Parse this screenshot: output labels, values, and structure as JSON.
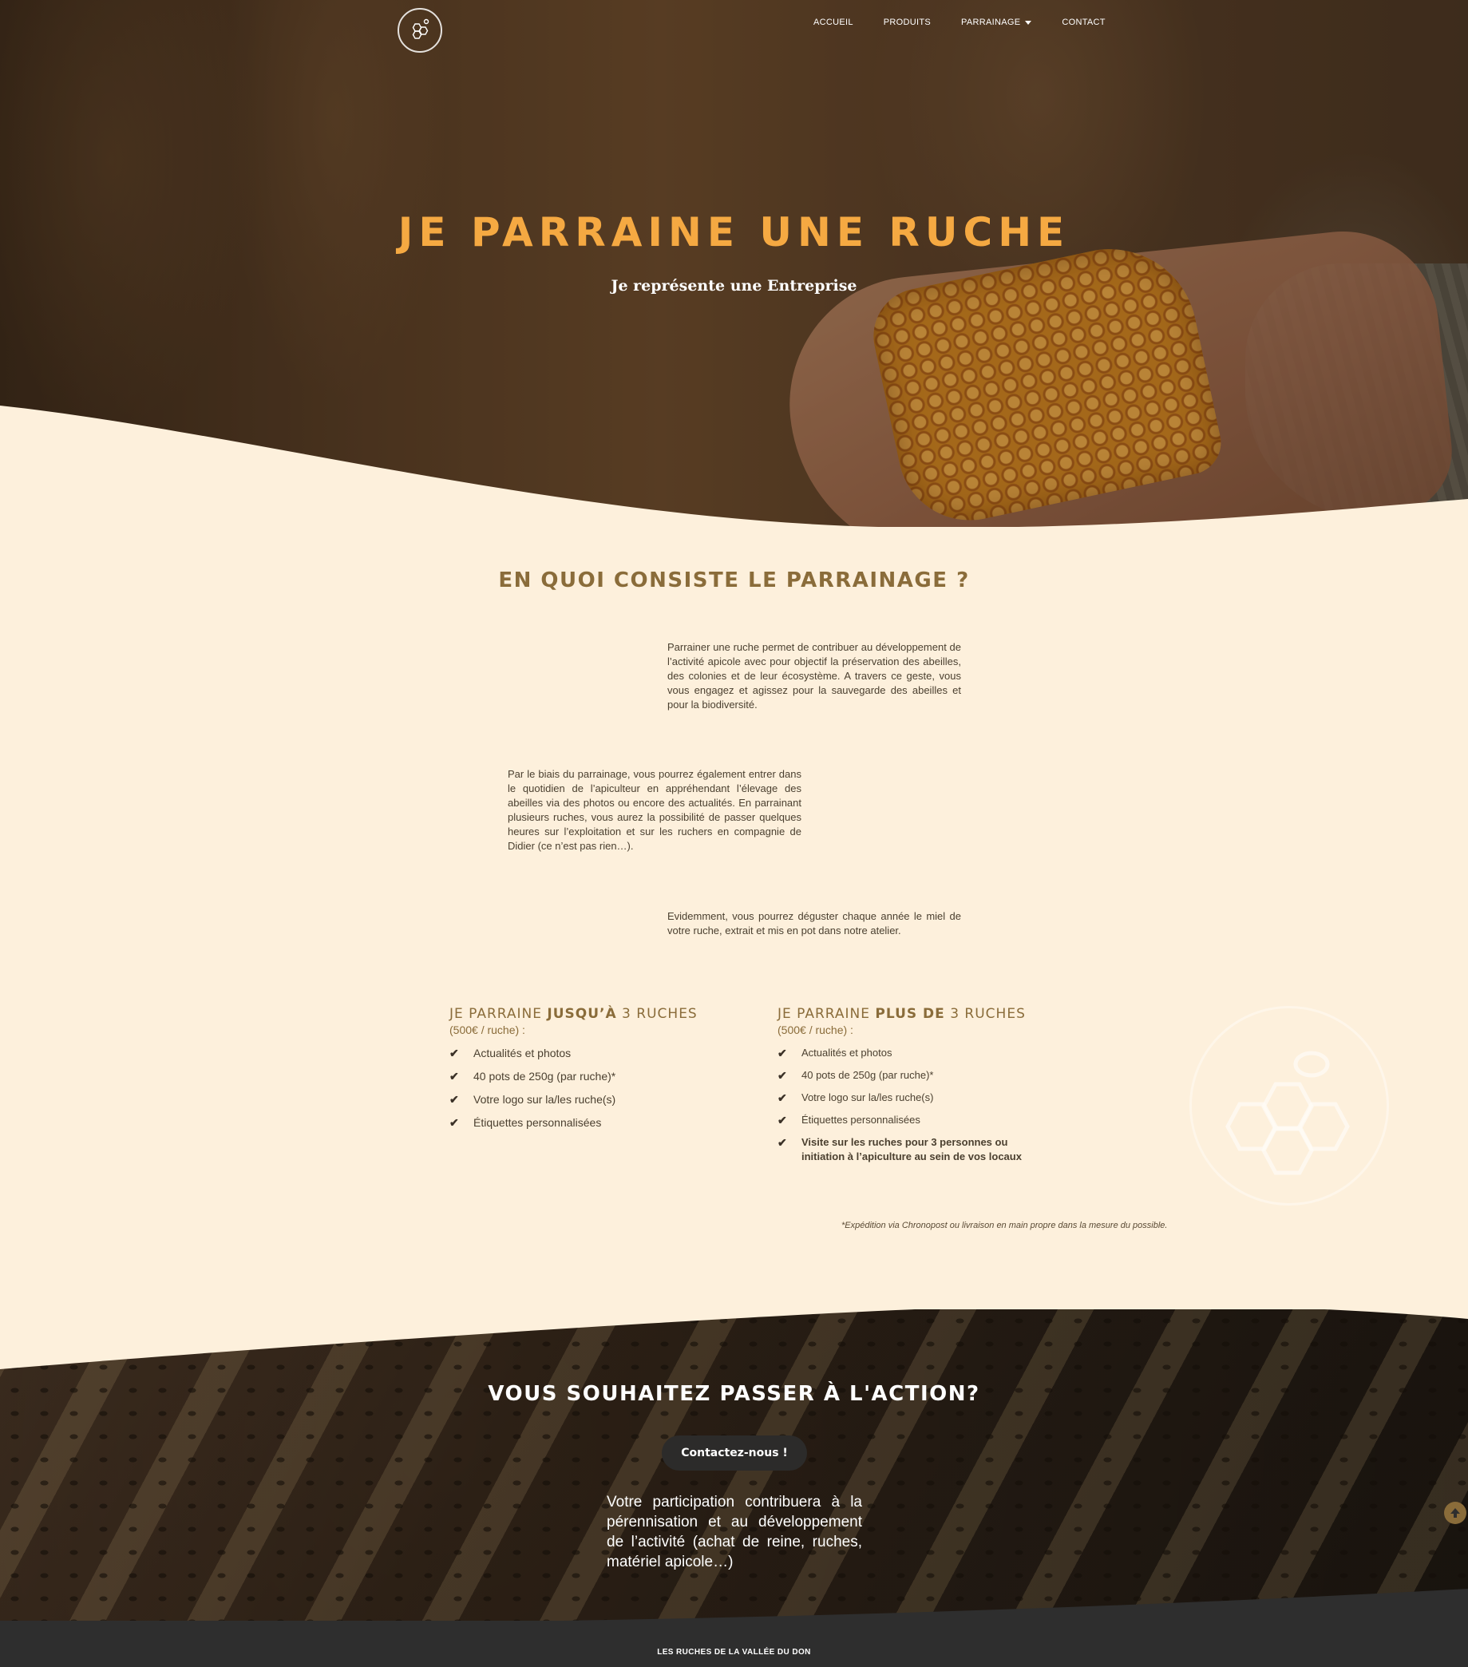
{
  "nav": {
    "logo_alt": "Les Ruches de la Vallée du Don",
    "items": [
      {
        "label": "ACCUEIL"
      },
      {
        "label": "PRODUITS"
      },
      {
        "label": "PARRAINAGE"
      },
      {
        "label": "CONTACT"
      }
    ]
  },
  "hero": {
    "title": "JE PARRAINE UNE RUCHE",
    "subtitle": "Je représente une Entreprise"
  },
  "about": {
    "title": "EN QUOI CONSISTE LE PARRAINAGE ?",
    "p1": "Parrainer une ruche permet de contribuer au développement de l’activité apicole avec pour objectif la préservation des abeilles, des colonies et de leur écosystème. A travers ce geste, vous vous engagez et agissez pour la sauvegarde des abeilles et pour la biodiversité.",
    "p2": "Par le biais du parrainage, vous pourrez également entrer dans le quotidien de l’apiculteur en appréhendant l’élevage des abeilles via des photos ou encore des actualités. En parrainant plusieurs ruches, vous aurez la possibilité de passer quelques heures sur l’exploitation et sur les ruchers en compagnie de Didier (ce n’est pas rien…).",
    "p3": "Evidemment, vous pourrez déguster chaque année le miel de votre ruche, extrait et mis en pot dans notre atelier."
  },
  "offers": [
    {
      "title_pre": "JE PARRAINE ",
      "title_bold": "JUSQU’À",
      "title_post": " 3 RUCHES",
      "price": "(500€ / ruche) :",
      "items": [
        "Actualités et photos",
        "40 pots de 250g (par ruche)*",
        "Votre logo sur la/les ruche(s)",
        "Étiquettes personnalisées"
      ]
    },
    {
      "title_pre": "JE PARRAINE ",
      "title_bold": "PLUS DE",
      "title_post": " 3 RUCHES",
      "price": "(500€ / ruche) :",
      "items": [
        "Actualités et photos",
        "40 pots de 250g (par ruche)*",
        "Votre logo sur la/les ruche(s)",
        "Étiquettes personnalisées",
        "Visite sur les ruches pour 3 personnes ou initiation à l’apiculture au sein de vos locaux"
      ]
    }
  ],
  "footnote": "*Expédition via Chronopost ou livraison en main propre dans la mesure du possible.",
  "cta": {
    "title": "VOUS SOUHAITEZ PASSER À L'ACTION?",
    "button": "Contactez-nous !",
    "text": "Votre participation contribuera à la pérennisation et au développement de l’activité (achat de reine, ruches, matériel apicole…)"
  },
  "footer": {
    "text": "LES RUCHES DE LA VALLÉE DU DON"
  },
  "colors": {
    "accent": "#f5a942",
    "heading": "#8a6c3a",
    "background": "#fdf0dc",
    "footer": "#2e2e2e"
  }
}
